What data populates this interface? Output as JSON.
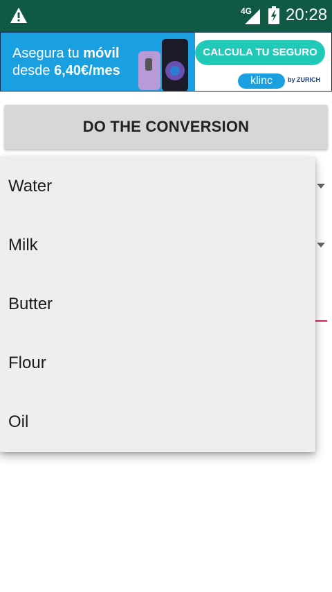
{
  "status_bar": {
    "network": "4G",
    "time": "20:28",
    "icons": [
      "warning-icon",
      "signal-icon",
      "battery-icon"
    ]
  },
  "ad": {
    "line1_prefix": "Asegura tu ",
    "line1_bold": "móvil",
    "line2_prefix": "desde ",
    "line2_bold": "6,40€/mes",
    "cta": "CALCULA TU SEGURO",
    "brand": "klinc",
    "partner": "ZURICH",
    "partner_prefix": "by"
  },
  "main": {
    "convert_button": "DO THE CONVERSION"
  },
  "dropdown": {
    "options": [
      "Water",
      "Milk",
      "Butter",
      "Flour",
      "Oil"
    ]
  },
  "colors": {
    "status_bar": "#0f5945",
    "ad_blue": "#1aa0e0",
    "ad_cta": "#20c9b8",
    "accent": "#d81b60",
    "dropdown_bg": "#eeeeee"
  }
}
